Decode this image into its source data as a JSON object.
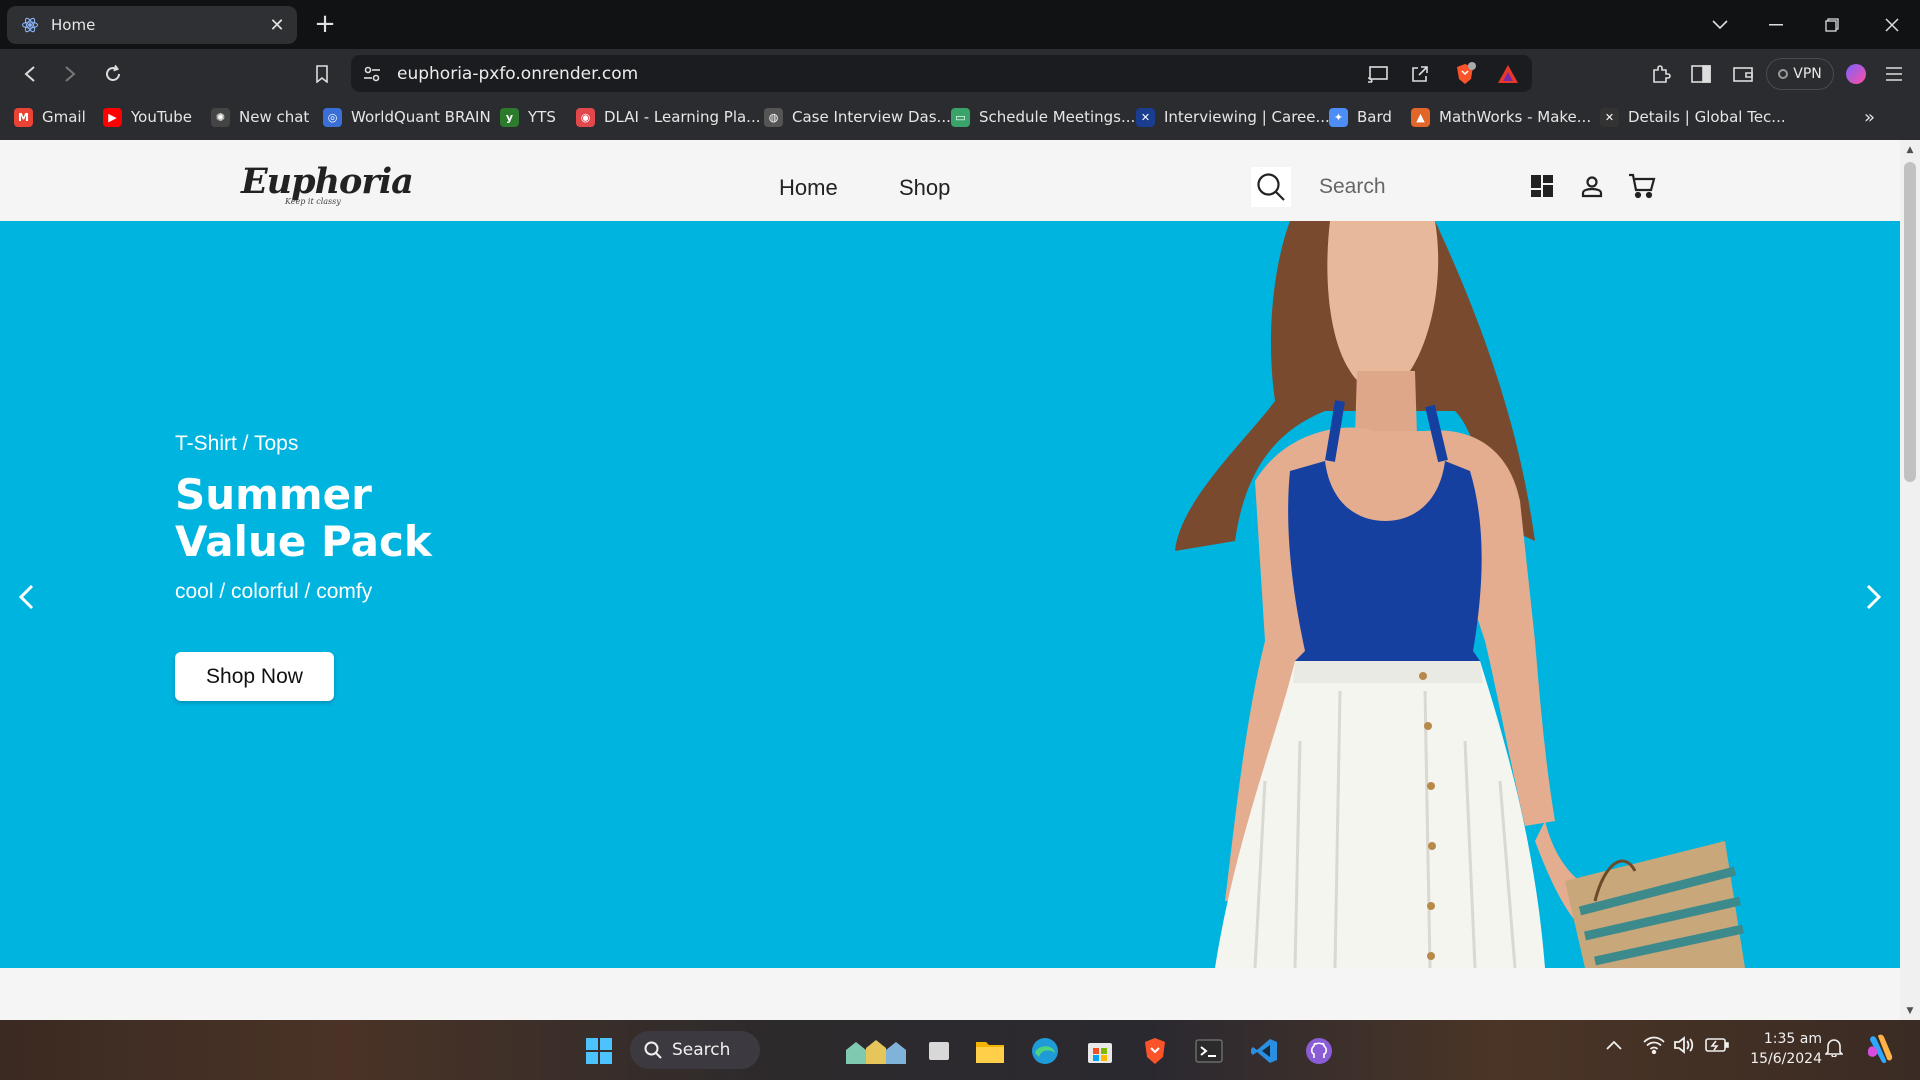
{
  "browser": {
    "tab": {
      "title": "Home"
    },
    "address": {
      "url": "euphoria-pxfo.onrender.com"
    },
    "vpn_label": "VPN",
    "bookmarks": [
      {
        "label": "Gmail",
        "color": "#ea4335",
        "glyph": "M"
      },
      {
        "label": "YouTube",
        "color": "#ff0000",
        "glyph": "▶"
      },
      {
        "label": "New chat",
        "color": "#444444",
        "glyph": "✺"
      },
      {
        "label": "WorldQuant BRAIN",
        "color": "#3b6fd8",
        "glyph": "◎"
      },
      {
        "label": "YTS",
        "color": "#2c7a2c",
        "glyph": "y"
      },
      {
        "label": "DLAI - Learning Pla...",
        "color": "#e2474b",
        "glyph": "◉"
      },
      {
        "label": "Case Interview Das...",
        "color": "#555555",
        "glyph": "◍"
      },
      {
        "label": "Schedule Meetings...",
        "color": "#3aa36a",
        "glyph": "▭"
      },
      {
        "label": "Interviewing | Caree...",
        "color": "#1a3d8f",
        "glyph": "✕"
      },
      {
        "label": "Bard",
        "color": "#4c8df6",
        "glyph": "✦"
      },
      {
        "label": "MathWorks - Make...",
        "color": "#e2662a",
        "glyph": "▲"
      },
      {
        "label": "Details | Global Tec...",
        "color": "#333333",
        "glyph": "✕"
      }
    ]
  },
  "site": {
    "logo": {
      "text": "Euphoria",
      "tagline": "Keep it classy"
    },
    "nav": {
      "home": "Home",
      "shop": "Shop"
    },
    "search": {
      "placeholder": "Search"
    }
  },
  "hero": {
    "category": "T-Shirt / Tops",
    "title_line1": "Summer",
    "title_line2": "Value Pack",
    "subtitle": "cool / colorful / comfy",
    "cta": "Shop Now",
    "background_color": "#00b4e0"
  },
  "taskbar": {
    "search_label": "Search",
    "time": "1:35 am",
    "date": "15/6/2024"
  }
}
